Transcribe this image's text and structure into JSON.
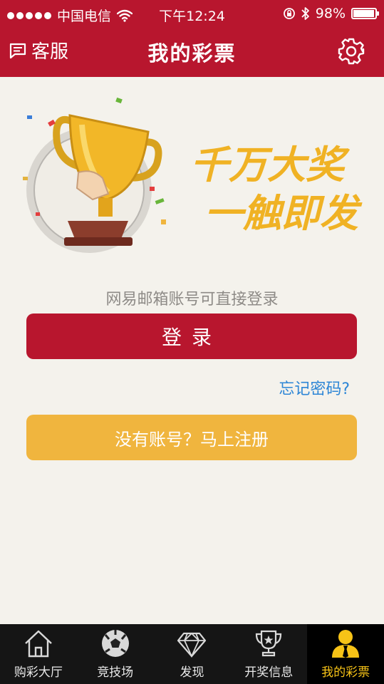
{
  "status_bar": {
    "carrier": "中国电信",
    "time": "下午12:24",
    "battery": "98%",
    "battery_level": 0.98
  },
  "nav": {
    "service_label": "客服",
    "title": "我的彩票",
    "settings_icon": "gear-icon"
  },
  "banner": {
    "line1": "千万大奖",
    "line2": "一触即发"
  },
  "login": {
    "hint": "网易邮箱账号可直接登录",
    "login_button": "登录",
    "forgot": "忘记密码?",
    "register_button": "没有账号？马上注册"
  },
  "tabs": [
    {
      "label": "购彩大厅",
      "icon": "house-icon",
      "active": false
    },
    {
      "label": "竞技场",
      "icon": "soccer-ball-icon",
      "active": false
    },
    {
      "label": "发现",
      "icon": "diamond-icon",
      "active": false
    },
    {
      "label": "开奖信息",
      "icon": "trophy-icon",
      "active": false
    },
    {
      "label": "我的彩票",
      "icon": "user-icon",
      "active": true
    }
  ],
  "colors": {
    "brand_red": "#b8162e",
    "register_yellow": "#f0b53e",
    "link_blue": "#2d86d6",
    "active_tab": "#f7c317"
  }
}
